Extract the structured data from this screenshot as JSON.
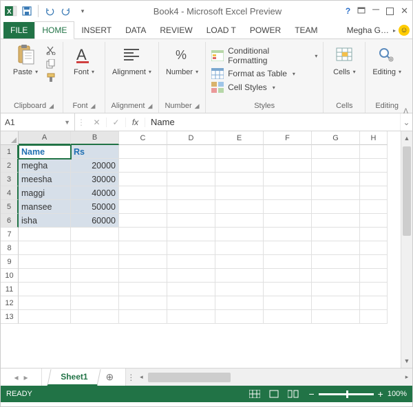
{
  "window": {
    "title": "Book4 - Microsoft Excel Preview"
  },
  "user": {
    "name": "Megha G…"
  },
  "tabs": {
    "file": "FILE",
    "home": "HOME",
    "insert": "INSERT",
    "data": "DATA",
    "review": "REVIEW",
    "loadt": "LOAD T",
    "power": "POWER",
    "team": "TEAM"
  },
  "ribbon": {
    "clipboard": {
      "paste": "Paste",
      "label": "Clipboard"
    },
    "font": {
      "btn": "Font",
      "label": "Font"
    },
    "alignment": {
      "btn": "Alignment",
      "label": "Alignment"
    },
    "number": {
      "btn": "Number",
      "label": "Number"
    },
    "styles": {
      "cond": "Conditional Formatting",
      "table": "Format as Table",
      "cell": "Cell Styles",
      "label": "Styles"
    },
    "cells": {
      "btn": "Cells",
      "label": "Cells"
    },
    "editing": {
      "btn": "Editing",
      "label": "Editing"
    }
  },
  "namebox": "A1",
  "formula": "Name",
  "columns": [
    "A",
    "B",
    "C",
    "D",
    "E",
    "F",
    "G",
    "H"
  ],
  "rows": [
    "1",
    "2",
    "3",
    "4",
    "5",
    "6",
    "7",
    "8",
    "9",
    "10",
    "11",
    "12",
    "13"
  ],
  "sheet": {
    "headers": {
      "a": "Name",
      "b": "Rs"
    },
    "data": [
      {
        "a": "megha",
        "b": "20000"
      },
      {
        "a": "meesha",
        "b": "30000"
      },
      {
        "a": "maggi",
        "b": "40000"
      },
      {
        "a": "mansee",
        "b": "50000"
      },
      {
        "a": "isha",
        "b": "60000"
      }
    ]
  },
  "sheet_tab": "Sheet1",
  "status": {
    "ready": "READY",
    "zoom": "100%"
  }
}
